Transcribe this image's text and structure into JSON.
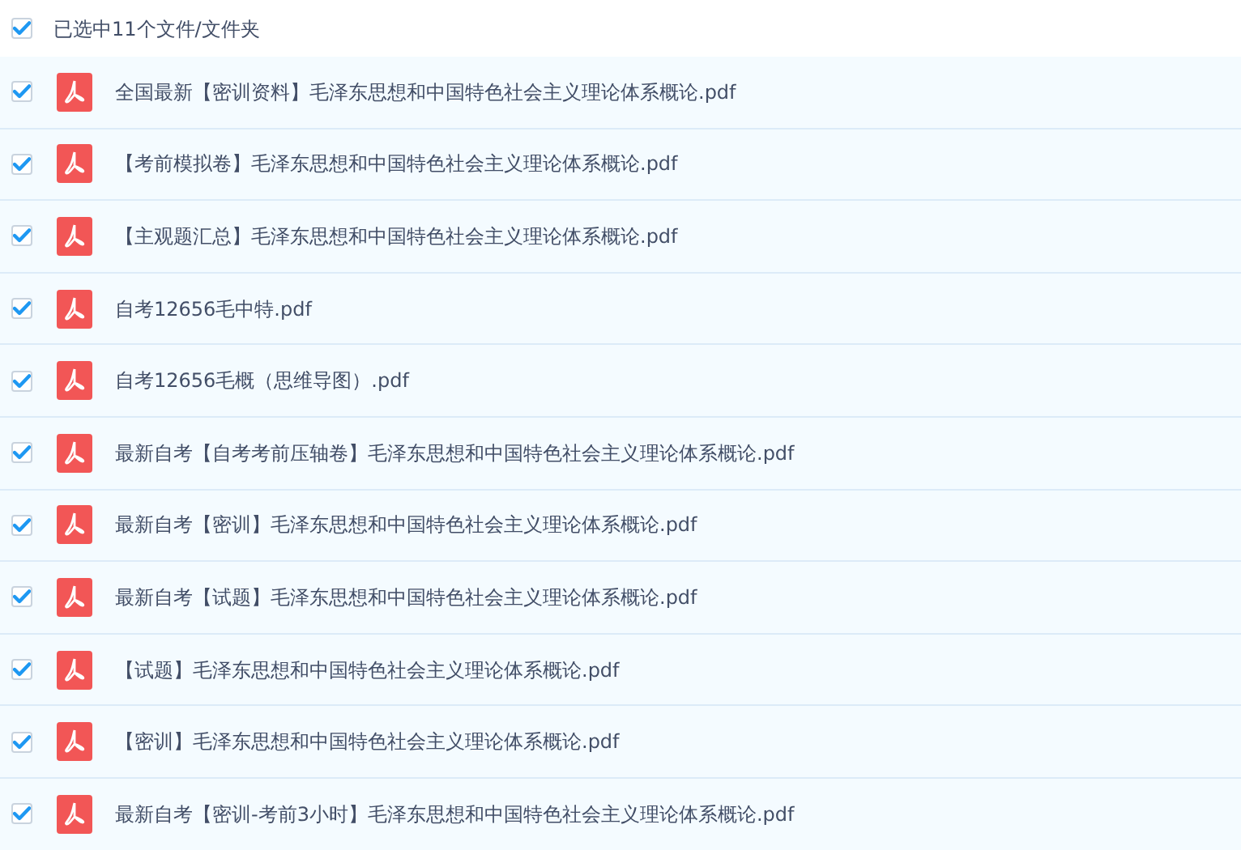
{
  "header": {
    "label": "已选中11个文件/文件夹",
    "checked": true
  },
  "files": [
    {
      "name": "全国最新【密训资料】毛泽东思想和中国特色社会主义理论体系概论.pdf",
      "checked": true
    },
    {
      "name": "【考前模拟卷】毛泽东思想和中国特色社会主义理论体系概论.pdf",
      "checked": true
    },
    {
      "name": "【主观题汇总】毛泽东思想和中国特色社会主义理论体系概论.pdf",
      "checked": true
    },
    {
      "name": "自考12656毛中特.pdf",
      "checked": true
    },
    {
      "name": "自考12656毛概（思维导图）.pdf",
      "checked": true
    },
    {
      "name": "最新自考【自考考前压轴卷】毛泽东思想和中国特色社会主义理论体系概论.pdf",
      "checked": true
    },
    {
      "name": "最新自考【密训】毛泽东思想和中国特色社会主义理论体系概论.pdf",
      "checked": true
    },
    {
      "name": "最新自考【试题】毛泽东思想和中国特色社会主义理论体系概论.pdf",
      "checked": true
    },
    {
      "name": "【试题】毛泽东思想和中国特色社会主义理论体系概论.pdf",
      "checked": true
    },
    {
      "name": "【密训】毛泽东思想和中国特色社会主义理论体系概论.pdf",
      "checked": true
    },
    {
      "name": "最新自考【密训-考前3小时】毛泽东思想和中国特色社会主义理论体系概论.pdf",
      "checked": true
    }
  ]
}
